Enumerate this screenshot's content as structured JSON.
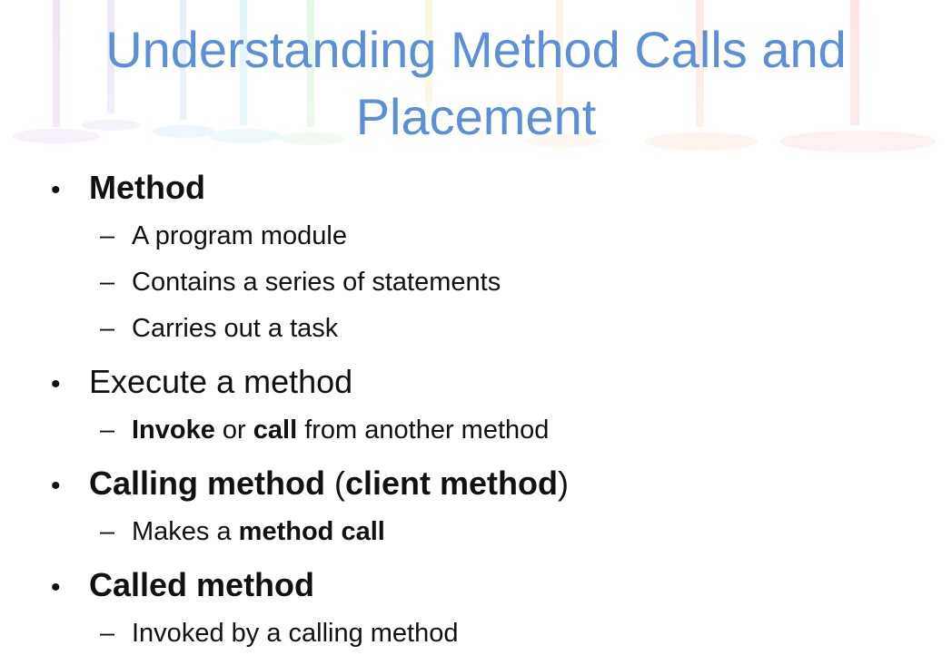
{
  "slide": {
    "title_line1": "Understanding Method Calls and",
    "title_line2": "Placement",
    "bullet_symbol": "•",
    "dash_symbol": "–",
    "colors": {
      "title": "#5b8fd6",
      "text": "#111111"
    },
    "items": [
      {
        "bold": "Method",
        "subs": [
          "A program module",
          "Contains a series of statements",
          "Carries out a task"
        ]
      },
      {
        "text": "Execute a method",
        "sub": {
          "b1": "Invoke",
          "t1": " or ",
          "b2": "call",
          "t2": " from another method"
        }
      },
      {
        "b1": "Calling method",
        "t1": " (",
        "b2": "client method",
        "t2": ")",
        "sub": {
          "t1": "Makes a ",
          "b1": "method call"
        }
      },
      {
        "bold": "Called method",
        "subs": [
          "Invoked by a calling method"
        ]
      }
    ]
  }
}
